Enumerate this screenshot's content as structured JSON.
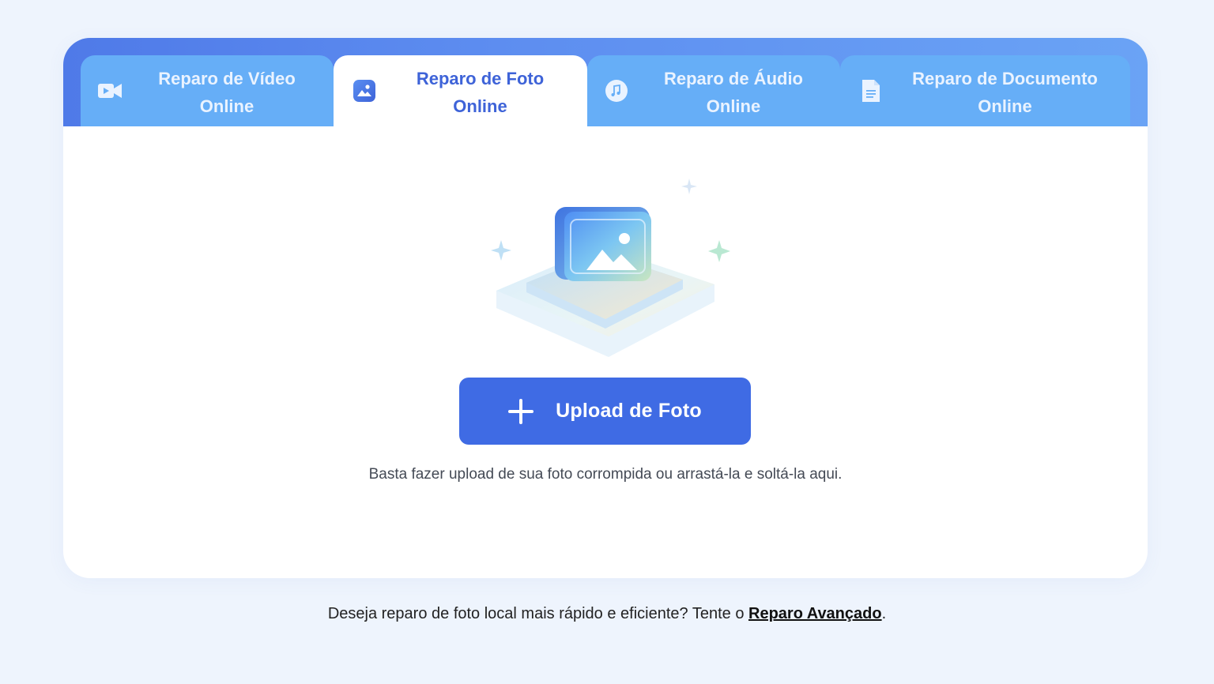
{
  "tabs": [
    {
      "line1": "Reparo de Vídeo",
      "line2": "Online",
      "icon": "video-camera-icon",
      "active": false
    },
    {
      "line1": "Reparo de Foto",
      "line2": "Online",
      "icon": "image-icon",
      "active": true
    },
    {
      "line1": "Reparo de Áudio",
      "line2": "Online",
      "icon": "music-note-icon",
      "active": false
    },
    {
      "line1": "Reparo de Documento",
      "line2": "Online",
      "icon": "document-icon",
      "active": false
    }
  ],
  "upload": {
    "button_label": "Upload de Foto",
    "hint": "Basta fazer upload de sua foto corrompida ou arrastá-la e soltá-la aqui."
  },
  "footer": {
    "text": "Deseja reparo de foto local mais rápido e eficiente? Tente o ",
    "link_label": "Reparo Avançado",
    "suffix": "."
  },
  "colors": {
    "accent": "#3f6be4",
    "tab_inactive": "#66aef7",
    "background": "#eef4fd"
  }
}
